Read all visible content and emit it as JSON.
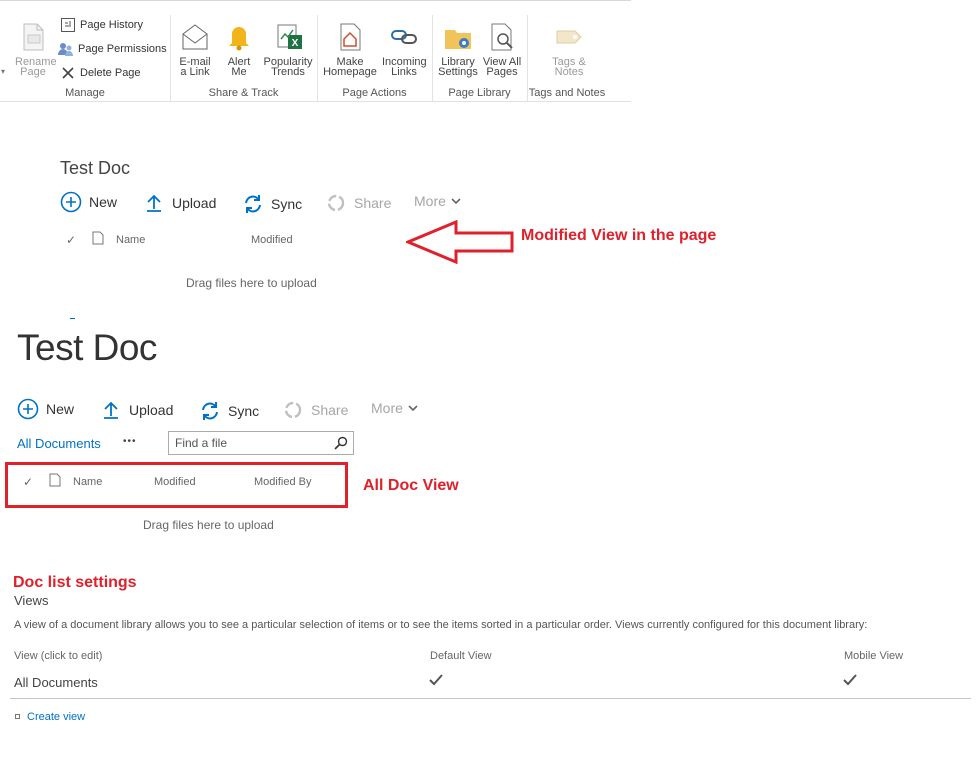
{
  "ribbon": {
    "manage": {
      "label": "Manage",
      "rename_page": "Rename Page",
      "page_history": "Page History",
      "page_permissions": "Page Permissions",
      "delete_page": "Delete Page"
    },
    "share_track": {
      "label": "Share & Track",
      "email_link": "E-mail a Link",
      "alert_me": "Alert Me",
      "popularity_trends": "Popularity Trends"
    },
    "page_actions": {
      "label": "Page Actions",
      "make_homepage": "Make Homepage",
      "incoming_links": "Incoming Links"
    },
    "page_library": {
      "label": "Page Library",
      "library_settings": "Library Settings",
      "view_all_pages": "View All Pages"
    },
    "tags_notes": {
      "label": "Tags and Notes",
      "tags_notes_btn": "Tags & Notes"
    }
  },
  "modified_view": {
    "title": "Test Doc",
    "commands": {
      "new": "New",
      "upload": "Upload",
      "sync": "Sync",
      "share": "Share",
      "more": "More"
    },
    "columns": {
      "name": "Name",
      "modified": "Modified"
    },
    "drag_text": "Drag files here to upload",
    "annotation": "Modified View in the page"
  },
  "all_doc_view": {
    "title": "Test Doc",
    "commands": {
      "new": "New",
      "upload": "Upload",
      "sync": "Sync",
      "share": "Share",
      "more": "More"
    },
    "view_name": "All Documents",
    "ellipsis": "•••",
    "search_placeholder": "Find a file",
    "columns": {
      "name": "Name",
      "modified": "Modified",
      "modified_by": "Modified By"
    },
    "drag_text": "Drag files here to upload",
    "annotation": "All Doc View"
  },
  "settings": {
    "annotation": "Doc list settings",
    "heading": "Views",
    "description": "A view of a document library allows you to see a particular selection of items or to see the items sorted in a particular order. Views currently configured for this document library:",
    "col_view": "View (click to edit)",
    "col_default": "Default View",
    "col_mobile": "Mobile View",
    "rows": [
      {
        "name": "All Documents",
        "default": true,
        "mobile": true
      }
    ],
    "create_view": "Create view"
  },
  "colors": {
    "accent": "#0072c6",
    "annotation": "#e0202a"
  }
}
